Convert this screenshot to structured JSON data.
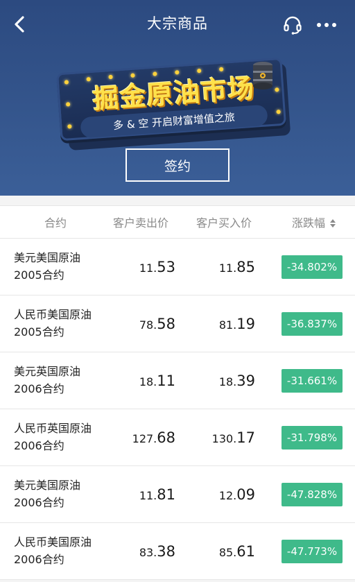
{
  "nav": {
    "title": "大宗商品"
  },
  "banner": {
    "title": "掘金原油市场",
    "subtitle": "多 & 空  开启财富增值之旅",
    "sign_button": "签约"
  },
  "table": {
    "headers": {
      "contract": "合约",
      "sell": "客户卖出价",
      "buy": "客户买入价",
      "change": "涨跌幅"
    },
    "rows": [
      {
        "name_line1": "美元美国原油",
        "name_line2": "2005合约",
        "sell_int": "11.",
        "sell_dec": "53",
        "buy_int": "11.",
        "buy_dec": "85",
        "change": "-34.802%"
      },
      {
        "name_line1": "人民币美国原油",
        "name_line2": "2005合约",
        "sell_int": "78.",
        "sell_dec": "58",
        "buy_int": "81.",
        "buy_dec": "19",
        "change": "-36.837%"
      },
      {
        "name_line1": "美元英国原油",
        "name_line2": "2006合约",
        "sell_int": "18.",
        "sell_dec": "11",
        "buy_int": "18.",
        "buy_dec": "39",
        "change": "-31.661%"
      },
      {
        "name_line1": "人民币英国原油",
        "name_line2": "2006合约",
        "sell_int": "127.",
        "sell_dec": "68",
        "buy_int": "130.",
        "buy_dec": "17",
        "change": "-31.798%"
      },
      {
        "name_line1": "美元美国原油",
        "name_line2": "2006合约",
        "sell_int": "11.",
        "sell_dec": "81",
        "buy_int": "12.",
        "buy_dec": "09",
        "change": "-47.828%"
      },
      {
        "name_line1": "人民币美国原油",
        "name_line2": "2006合约",
        "sell_int": "83.",
        "sell_dec": "38",
        "buy_int": "85.",
        "buy_dec": "61",
        "change": "-47.773%"
      }
    ]
  },
  "icons": {
    "back": "chevron-left-icon",
    "service": "headset-icon",
    "more": "more-dots-icon",
    "sort": "sort-icon",
    "barrel": "oil-barrel-icon"
  },
  "colors": {
    "header_bg": "#34558c",
    "badge_down": "#3fba8a",
    "sign_title": "#ffe14a"
  }
}
